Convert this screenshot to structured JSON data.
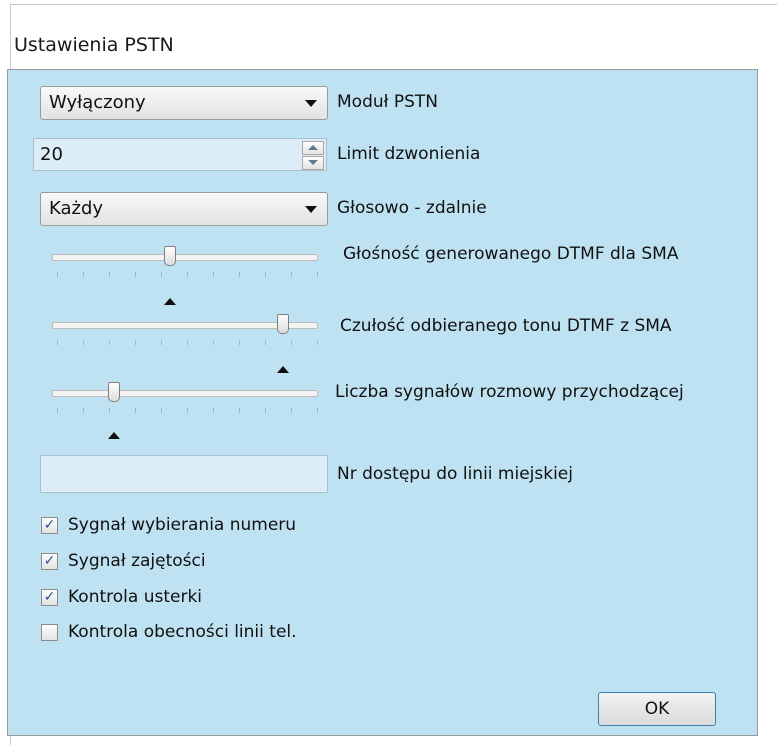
{
  "window": {
    "title": "Ustawienia PSTN"
  },
  "pstn_module": {
    "value": "Wyłączony",
    "label": "Moduł PSTN"
  },
  "ring_limit": {
    "value": "20",
    "label": "Limit dzwonienia"
  },
  "voice_remote": {
    "value": "Każdy",
    "label": "Głosowo - zdalnie"
  },
  "sliders": [
    {
      "label": "Głośność generowanego DTMF dla SMA",
      "level": 0.47
    },
    {
      "label": "Czułość odbieranego tonu DTMF z SMA",
      "level": 0.91
    },
    {
      "label": "Liczba sygnałów rozmowy przychodzącej",
      "level": 0.24
    }
  ],
  "line_access": {
    "value": "",
    "label": "Nr dostępu do linii miejskiej"
  },
  "checkboxes": [
    {
      "label": "Sygnał wybierania numeru",
      "checked": true
    },
    {
      "label": "Sygnał zajętości",
      "checked": true
    },
    {
      "label": "Kontrola usterki",
      "checked": true
    },
    {
      "label": "Kontrola obecności linii tel.",
      "checked": false
    }
  ],
  "ok_button": {
    "label": "OK"
  },
  "check_mark": "✓"
}
